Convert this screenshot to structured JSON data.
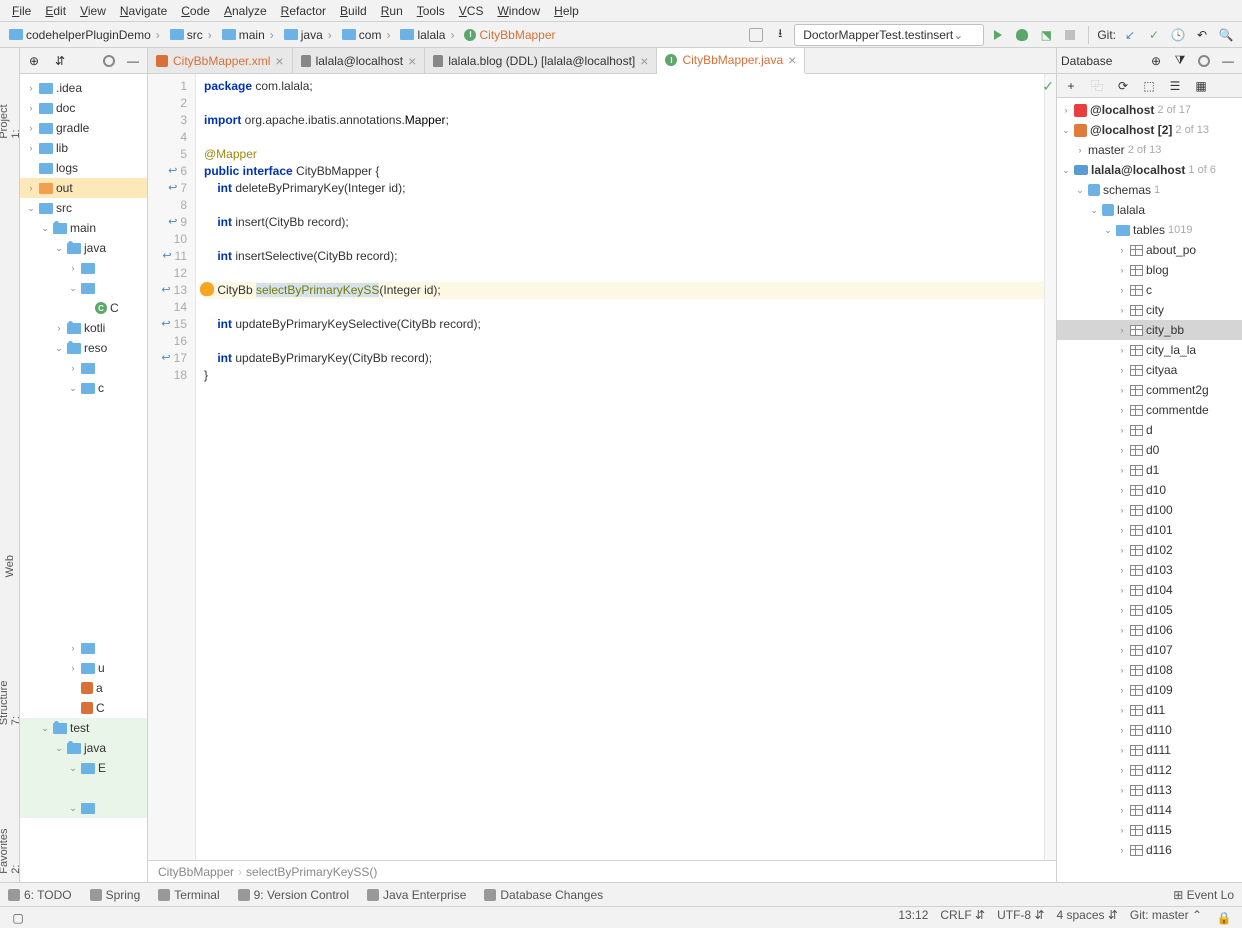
{
  "menu": [
    "File",
    "Edit",
    "View",
    "Navigate",
    "Code",
    "Analyze",
    "Refactor",
    "Build",
    "Run",
    "Tools",
    "VCS",
    "Window",
    "Help"
  ],
  "breadcrumb": [
    "codehelperPluginDemo",
    "src",
    "main",
    "java",
    "com",
    "lalala",
    "CityBbMapper"
  ],
  "runConfig": "DoctorMapperTest.testinsert",
  "gitLabel": "Git:",
  "projectTree": [
    {
      "d": 0,
      "c": "›",
      "i": "folder",
      "t": ".idea"
    },
    {
      "d": 0,
      "c": "›",
      "i": "folder",
      "t": "doc"
    },
    {
      "d": 0,
      "c": "›",
      "i": "folder",
      "t": "gradle"
    },
    {
      "d": 0,
      "c": "›",
      "i": "folder",
      "t": "lib"
    },
    {
      "d": 0,
      "c": " ",
      "i": "folder",
      "t": "logs"
    },
    {
      "d": 0,
      "c": "›",
      "i": "folder-o",
      "t": "out",
      "sel": true
    },
    {
      "d": 0,
      "c": "⌄",
      "i": "folder",
      "t": "src"
    },
    {
      "d": 1,
      "c": "⌄",
      "i": "mod",
      "t": "main"
    },
    {
      "d": 2,
      "c": "⌄",
      "i": "mod",
      "t": "java"
    },
    {
      "d": 3,
      "c": "›",
      "i": "folder",
      "t": ""
    },
    {
      "d": 3,
      "c": "⌄",
      "i": "folder",
      "t": ""
    },
    {
      "d": 4,
      "c": " ",
      "i": "class",
      "t": "C"
    },
    {
      "d": 2,
      "c": "›",
      "i": "mod",
      "t": "kotli"
    },
    {
      "d": 2,
      "c": "⌄",
      "i": "mod",
      "t": "reso"
    },
    {
      "d": 3,
      "c": "›",
      "i": "folder",
      "t": ""
    },
    {
      "d": 3,
      "c": "⌄",
      "i": "folder",
      "t": "c"
    }
  ],
  "projectTree2": [
    {
      "d": 3,
      "c": "›",
      "i": "folder",
      "t": ""
    },
    {
      "d": 3,
      "c": "›",
      "i": "folder",
      "t": "u"
    },
    {
      "d": 3,
      "c": " ",
      "i": "xml",
      "t": "a"
    },
    {
      "d": 3,
      "c": " ",
      "i": "xml",
      "t": "C"
    },
    {
      "d": 1,
      "c": "⌄",
      "i": "mod",
      "t": "test",
      "green": true
    },
    {
      "d": 2,
      "c": "⌄",
      "i": "mod",
      "t": "java",
      "green": true
    },
    {
      "d": 3,
      "c": "⌄",
      "i": "folder",
      "t": "E",
      "green": true
    },
    {
      "d": 3,
      "c": " ",
      "i": "",
      "t": "",
      "green": true
    },
    {
      "d": 3,
      "c": "⌄",
      "i": "folder",
      "t": "",
      "green": true
    }
  ],
  "tabs": [
    {
      "icon": "xml",
      "label": "CityBbMapper.xml",
      "active": false
    },
    {
      "icon": "db",
      "label": "lalala@localhost",
      "active": false
    },
    {
      "icon": "db",
      "label": "lalala.blog (DDL) [lalala@localhost]",
      "active": false
    },
    {
      "icon": "class",
      "label": "CityBbMapper.java",
      "active": true
    }
  ],
  "code": {
    "lines": [
      {
        "n": 1,
        "html": "<span class='kw'>package</span> com.lalala;"
      },
      {
        "n": 2,
        "html": ""
      },
      {
        "n": 3,
        "html": "<span class='kw'>import</span> org.apache.ibatis.annotations.<span class='typ'>Mapper</span>;"
      },
      {
        "n": 4,
        "html": ""
      },
      {
        "n": 5,
        "html": "<span class='ann'>@Mapper</span>"
      },
      {
        "n": 6,
        "html": "<span class='kw'>public interface</span> CityBbMapper {",
        "impl": true
      },
      {
        "n": 7,
        "html": "    <span class='kw'>int</span> deleteByPrimaryKey(Integer id);",
        "impl": true
      },
      {
        "n": 8,
        "html": ""
      },
      {
        "n": 9,
        "html": "    <span class='kw'>int</span> insert(CityBb record);",
        "impl": true
      },
      {
        "n": 10,
        "html": ""
      },
      {
        "n": 11,
        "html": "    <span class='kw'>int</span> insertSelective(CityBb record);",
        "impl": true
      },
      {
        "n": 12,
        "html": ""
      },
      {
        "n": 13,
        "html": "    CityBb <span class='mth sel-txt'>selectByPrimaryKeySS</span>(Integer id);",
        "impl": true,
        "hl": true,
        "bulb": true
      },
      {
        "n": 14,
        "html": ""
      },
      {
        "n": 15,
        "html": "    <span class='kw'>int</span> updateByPrimaryKeySelective(CityBb record);",
        "impl": true
      },
      {
        "n": 16,
        "html": ""
      },
      {
        "n": 17,
        "html": "    <span class='kw'>int</span> updateByPrimaryKey(CityBb record);",
        "impl": true
      },
      {
        "n": 18,
        "html": "}"
      }
    ]
  },
  "editorCrumb": [
    "CityBbMapper",
    "selectByPrimaryKeySS()"
  ],
  "dbPanel": {
    "title": "Database",
    "items": [
      {
        "d": 0,
        "c": "›",
        "i": "oracle",
        "t": "@localhost",
        "cnt": "2 of 17"
      },
      {
        "d": 0,
        "c": "⌄",
        "i": "pg",
        "t": "@localhost [2]",
        "cnt": "2 of 13"
      },
      {
        "d": 1,
        "c": "›",
        "i": "",
        "t": "master",
        "cnt": "2 of 13"
      },
      {
        "d": 0,
        "c": "⌄",
        "i": "my",
        "t": "lalala@localhost",
        "cnt": "1 of 6"
      },
      {
        "d": 1,
        "c": "⌄",
        "i": "schema",
        "t": "schemas",
        "cnt": "1"
      },
      {
        "d": 2,
        "c": "⌄",
        "i": "schema",
        "t": "lalala"
      },
      {
        "d": 3,
        "c": "⌄",
        "i": "folder",
        "t": "tables",
        "cnt": "1019"
      },
      {
        "d": 4,
        "c": "›",
        "i": "tbl",
        "t": "about_po"
      },
      {
        "d": 4,
        "c": "›",
        "i": "tbl",
        "t": "blog"
      },
      {
        "d": 4,
        "c": "›",
        "i": "tbl",
        "t": "c"
      },
      {
        "d": 4,
        "c": "›",
        "i": "tbl",
        "t": "city"
      },
      {
        "d": 4,
        "c": "›",
        "i": "tbl",
        "t": "city_bb",
        "sel": true
      },
      {
        "d": 4,
        "c": "›",
        "i": "tbl",
        "t": "city_la_la"
      },
      {
        "d": 4,
        "c": "›",
        "i": "tbl",
        "t": "cityaa"
      },
      {
        "d": 4,
        "c": "›",
        "i": "tbl",
        "t": "comment2g"
      },
      {
        "d": 4,
        "c": "›",
        "i": "tbl",
        "t": "commentde"
      },
      {
        "d": 4,
        "c": "›",
        "i": "tbl",
        "t": "d"
      },
      {
        "d": 4,
        "c": "›",
        "i": "tbl",
        "t": "d0"
      },
      {
        "d": 4,
        "c": "›",
        "i": "tbl",
        "t": "d1"
      },
      {
        "d": 4,
        "c": "›",
        "i": "tbl",
        "t": "d10"
      },
      {
        "d": 4,
        "c": "›",
        "i": "tbl",
        "t": "d100"
      },
      {
        "d": 4,
        "c": "›",
        "i": "tbl",
        "t": "d101"
      },
      {
        "d": 4,
        "c": "›",
        "i": "tbl",
        "t": "d102"
      },
      {
        "d": 4,
        "c": "›",
        "i": "tbl",
        "t": "d103"
      },
      {
        "d": 4,
        "c": "›",
        "i": "tbl",
        "t": "d104"
      },
      {
        "d": 4,
        "c": "›",
        "i": "tbl",
        "t": "d105"
      },
      {
        "d": 4,
        "c": "›",
        "i": "tbl",
        "t": "d106"
      },
      {
        "d": 4,
        "c": "›",
        "i": "tbl",
        "t": "d107"
      },
      {
        "d": 4,
        "c": "›",
        "i": "tbl",
        "t": "d108"
      },
      {
        "d": 4,
        "c": "›",
        "i": "tbl",
        "t": "d109"
      },
      {
        "d": 4,
        "c": "›",
        "i": "tbl",
        "t": "d11"
      },
      {
        "d": 4,
        "c": "›",
        "i": "tbl",
        "t": "d110"
      },
      {
        "d": 4,
        "c": "›",
        "i": "tbl",
        "t": "d111"
      },
      {
        "d": 4,
        "c": "›",
        "i": "tbl",
        "t": "d112"
      },
      {
        "d": 4,
        "c": "›",
        "i": "tbl",
        "t": "d113"
      },
      {
        "d": 4,
        "c": "›",
        "i": "tbl",
        "t": "d114"
      },
      {
        "d": 4,
        "c": "›",
        "i": "tbl",
        "t": "d115"
      },
      {
        "d": 4,
        "c": "›",
        "i": "tbl",
        "t": "d116"
      }
    ]
  },
  "bottomTabs": [
    "6: TODO",
    "Spring",
    "Terminal",
    "9: Version Control",
    "Java Enterprise",
    "Database Changes"
  ],
  "eventLog": "Event Lo",
  "status": {
    "pos": "13:12",
    "sep": "CRLF",
    "enc": "UTF-8",
    "indent": "4 spaces",
    "git": "Git: master"
  },
  "leftTabs": [
    "1: Project",
    "Web",
    "7: Structure",
    "2: Favorites"
  ]
}
